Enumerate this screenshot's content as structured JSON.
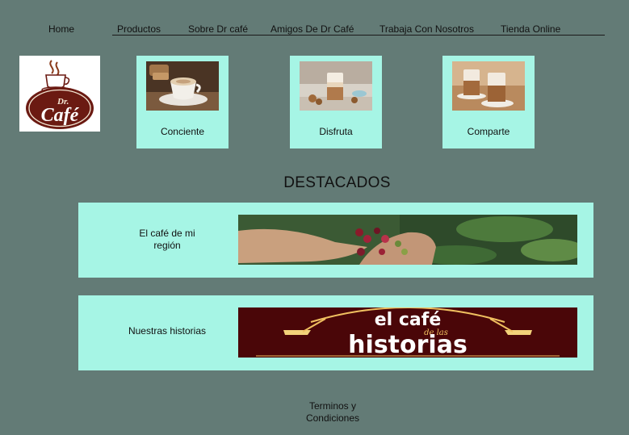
{
  "nav": {
    "home": "Home",
    "productos": "Productos",
    "sobre": "Sobre Dr café",
    "amigos": "Amigos De Dr Café",
    "trabaja": "Trabaja Con Nosotros",
    "tienda": "Tienda Online"
  },
  "logo": {
    "line1": "Dr.",
    "line2": "Café"
  },
  "cards": [
    {
      "label": "Conciente",
      "icon": "coffee-cup-photo"
    },
    {
      "label": "Disfruta",
      "icon": "latte-glass-photo"
    },
    {
      "label": "Comparte",
      "icon": "two-lattes-photo"
    }
  ],
  "section_title": "DESTACADOS",
  "featured": [
    {
      "text": "El café de mi región",
      "icon": "coffee-cherries-photo"
    },
    {
      "text": "Nuestras historias",
      "banner_line1": "el café",
      "banner_line2": "de las",
      "banner_line3": "historias"
    }
  ],
  "footer": {
    "link": "Terminos y Condiciones"
  },
  "colors": {
    "background": "#637b76",
    "panel": "#a6f5e5",
    "logo_brown": "#6b1a12"
  }
}
